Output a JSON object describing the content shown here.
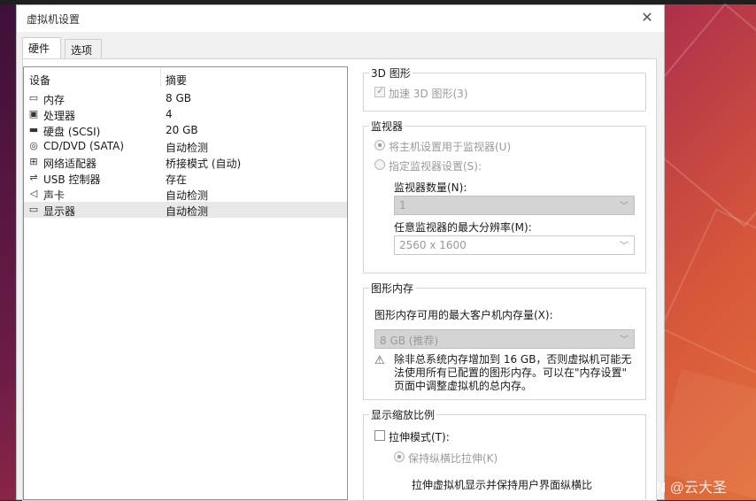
{
  "window": {
    "title": "虚拟机设置"
  },
  "tabs": [
    {
      "label": "硬件"
    },
    {
      "label": "选项"
    }
  ],
  "device_list": {
    "columns": {
      "device": "设备",
      "summary": "摘要"
    },
    "rows": [
      {
        "icon": "memory-icon",
        "name": "内存",
        "summary": "8 GB"
      },
      {
        "icon": "processor-icon",
        "name": "处理器",
        "summary": "4"
      },
      {
        "icon": "hard-disk-icon",
        "name": "硬盘 (SCSI)",
        "summary": "20 GB"
      },
      {
        "icon": "cd-dvd-icon",
        "name": "CD/DVD (SATA)",
        "summary": "自动检测"
      },
      {
        "icon": "network-adapter-icon",
        "name": "网络适配器",
        "summary": "桥接模式 (自动)"
      },
      {
        "icon": "usb-controller-icon",
        "name": "USB 控制器",
        "summary": "存在"
      },
      {
        "icon": "sound-card-icon",
        "name": "声卡",
        "summary": "自动检测"
      },
      {
        "icon": "display-icon",
        "name": "显示器",
        "summary": "自动检测"
      }
    ],
    "selected_index": 7
  },
  "graphics_3d": {
    "legend": "3D 图形",
    "accelerate_label": "加速 3D 图形(3)"
  },
  "monitors": {
    "legend": "监视器",
    "use_host_label": "将主机设置用于监视器(U)",
    "specify_label": "指定监视器设置(S):",
    "count_label": "监视器数量(N):",
    "count_value": "1",
    "max_res_label": "任意监视器的最大分辨率(M):",
    "max_res_value": "2560 x 1600"
  },
  "graphics_memory": {
    "legend": "图形内存",
    "max_label": "图形内存可用的最大客户机内存量(X):",
    "value": "8 GB (推荐)",
    "warning_line1": "除非总系统内存增加到 16 GB，否则虚拟机可能无",
    "warning_line2": "法使用所有已配置的图形内存。可以在\"内存设置\"",
    "warning_line3": "页面中调整虚拟机的总内存。"
  },
  "display_scaling": {
    "legend": "显示缩放比例",
    "stretch_label": "拉伸模式(T):",
    "keep_aspect_label": "保持纵横比拉伸(K)",
    "description": "拉伸虚拟机显示并保持用户界面纵横比"
  },
  "watermark": "CSDN @云大圣"
}
